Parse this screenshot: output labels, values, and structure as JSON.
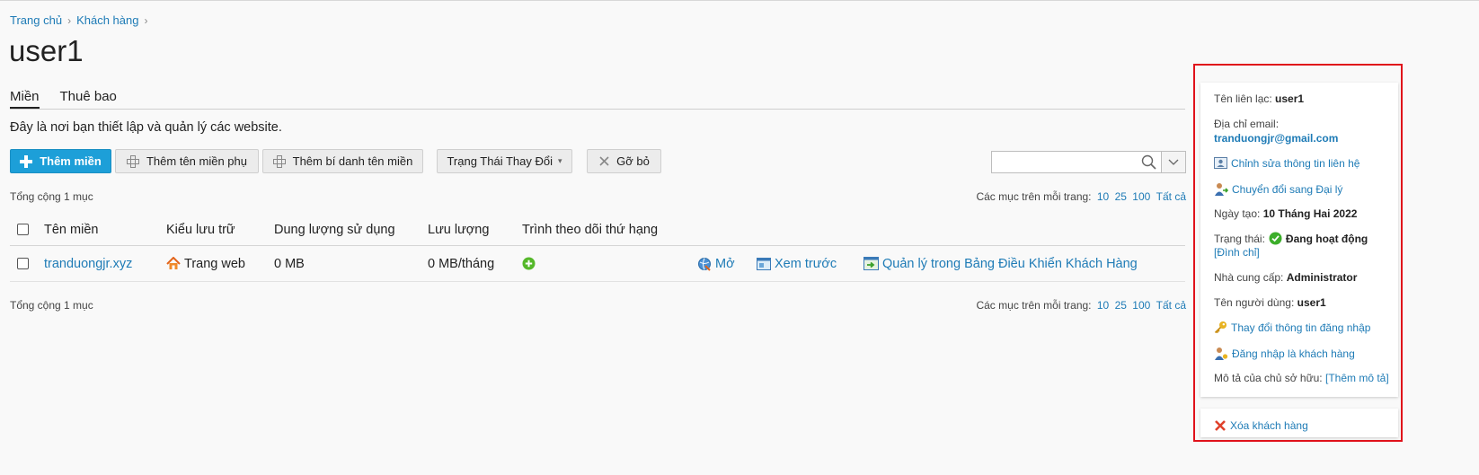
{
  "breadcrumb": [
    "Trang chủ",
    "Khách hàng"
  ],
  "page_title": "user1",
  "tabs": [
    {
      "label": "Miền",
      "active": true
    },
    {
      "label": "Thuê bao",
      "active": false
    }
  ],
  "intro": "Đây là nơi bạn thiết lập và quản lý các website.",
  "toolbar": {
    "add_domain": "Thêm miền",
    "add_subdomain": "Thêm tên miền phụ",
    "add_alias": "Thêm bí danh tên miền",
    "change_status": "Trạng Thái Thay Đổi",
    "remove": "Gỡ bỏ"
  },
  "search": {
    "value": "",
    "placeholder": ""
  },
  "total_text": "Tổng cộng 1 mục",
  "per_page": {
    "label": "Các mục trên mỗi trang:",
    "options": [
      "10",
      "25",
      "100",
      "Tất cả"
    ]
  },
  "table": {
    "headers": [
      "Tên miền",
      "Kiểu lưu trữ",
      "Dung lượng sử dụng",
      "Lưu lượng",
      "Trình theo dõi thứ hạng"
    ],
    "rows": [
      {
        "domain": "tranduongjr.xyz",
        "hosting": "Trang web",
        "disk": "0 MB",
        "traffic": "0 MB/tháng",
        "open": "Mở",
        "preview": "Xem trước",
        "manage": "Quản lý trong Bảng Điều Khiển Khách Hàng"
      }
    ]
  },
  "sidebar": {
    "contact_label": "Tên liên lạc:",
    "contact_value": "user1",
    "email_label": "Địa chỉ email:",
    "email_value": "tranduongjr@gmail.com",
    "edit_contact": "Chỉnh sửa thông tin liên hệ",
    "convert_reseller": "Chuyển đổi sang Đại lý",
    "created_label": "Ngày tạo:",
    "created_value": "10 Tháng Hai 2022",
    "status_label": "Trạng thái:",
    "status_value": "Đang hoạt động",
    "suspend_link": "[Đình chỉ]",
    "provider_label": "Nhà cung cấp:",
    "provider_value": "Administrator",
    "username_label": "Tên người dùng:",
    "username_value": "user1",
    "change_login": "Thay đổi thông tin đăng nhập",
    "login_as": "Đăng nhập là khách hàng",
    "owner_desc_label": "Mô tả của chủ sở hữu:",
    "owner_desc_link": "[Thêm mô tả]",
    "delete_customer": "Xóa khách hàng"
  },
  "colors": {
    "primary": "#1d9fd8",
    "link": "#1e7bb6",
    "highlight_frame": "#e0121b",
    "status_ok": "#3cae2a"
  }
}
